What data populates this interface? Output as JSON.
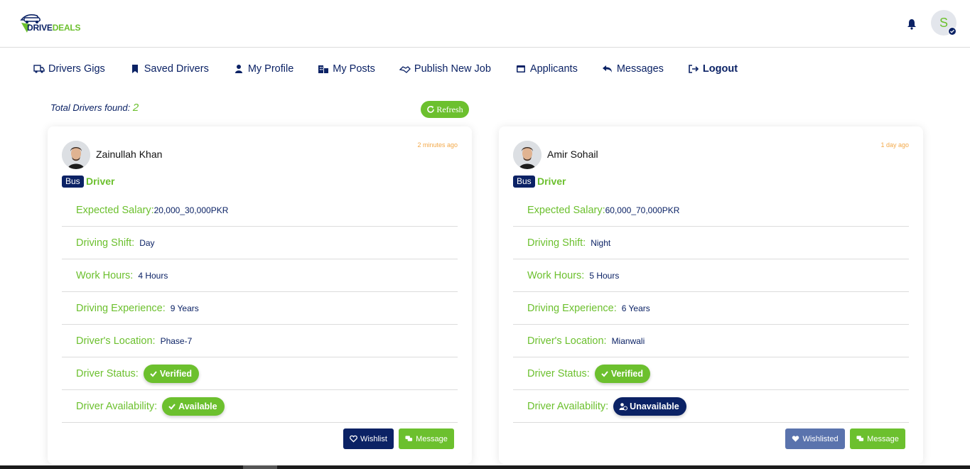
{
  "app": {
    "logo_part1": "DRIVE",
    "logo_part2": "DEALS",
    "avatar_initial": "S"
  },
  "nav": [
    {
      "label": "Drivers Gigs",
      "icon": "truck-icon"
    },
    {
      "label": "Saved Drivers",
      "icon": "bookmark-icon"
    },
    {
      "label": "My Profile",
      "icon": "user-icon"
    },
    {
      "label": "My Posts",
      "icon": "building-icon"
    },
    {
      "label": "Publish New Job",
      "icon": "handshake-icon"
    },
    {
      "label": "Applicants",
      "icon": "id-card-icon"
    },
    {
      "label": "Messages",
      "icon": "reply-icon"
    },
    {
      "label": "Logout",
      "icon": "logout-icon"
    }
  ],
  "summary": {
    "total_label": "Total Drivers found:",
    "total_count": "2",
    "refresh_label": "Refresh"
  },
  "labels": {
    "salary": "Expected Salary:",
    "shift": "Driving Shift:",
    "hours": "Work Hours:",
    "experience": "Driving Experience:",
    "location": "Driver's Location:",
    "status": "Driver Status:",
    "availability": "Driver Availability:"
  },
  "drivers": [
    {
      "name": "Zainullah Khan",
      "posted": "2 minutes ago",
      "vehicle": "Bus",
      "role": "Driver",
      "salary": "20,000_30,000PKR",
      "shift": "Day",
      "hours": "4 Hours",
      "experience": "9 Years",
      "location": "Phase-7",
      "status": "Verified",
      "availability": "Available",
      "wishlist_label": "Wishlist",
      "message_label": "Message"
    },
    {
      "name": "Amir Sohail",
      "posted": "1 day ago",
      "vehicle": "Bus",
      "role": "Driver",
      "salary": "60,000_70,000PKR",
      "shift": "Night",
      "hours": "5 Hours",
      "experience": "6 Years",
      "location": "Mianwali",
      "status": "Verified",
      "availability": "Unavailable",
      "wishlist_label": "Wishlisted",
      "message_label": "Message"
    }
  ],
  "colors": {
    "brand_navy": "#0b2265",
    "brand_green": "#6cc02e",
    "timestamp": "#f3a94a",
    "wishlisted": "#5a73ad"
  }
}
